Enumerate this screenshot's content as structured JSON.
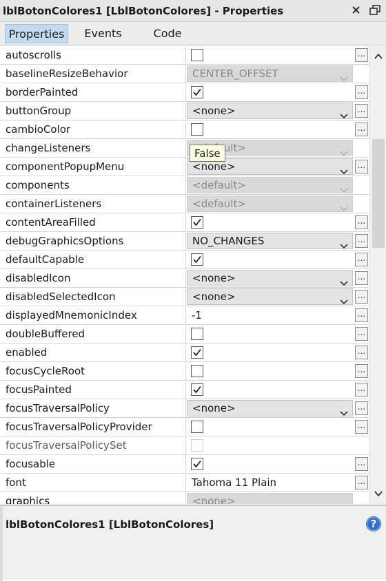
{
  "window": {
    "title": "lblBotonColores1 [LblBotonColores] - Properties",
    "close_icon": "close-icon",
    "maximize_icon": "maximize-icon"
  },
  "tabs": [
    {
      "label": "Properties",
      "active": true
    },
    {
      "label": "Events",
      "active": false
    },
    {
      "label": "Code",
      "active": false
    }
  ],
  "properties": [
    {
      "name": "autoscrolls",
      "type": "checkbox",
      "checked": false,
      "editor": true
    },
    {
      "name": "baselineResizeBehavior",
      "type": "combo",
      "value": "CENTER_OFFSET",
      "disabled": true,
      "editor": false
    },
    {
      "name": "borderPainted",
      "type": "checkbox",
      "checked": true,
      "editor": true
    },
    {
      "name": "buttonGroup",
      "type": "combo",
      "value": "<none>",
      "disabled": false,
      "editor": true
    },
    {
      "name": "cambioColor",
      "type": "checkbox",
      "checked": false,
      "editor": true
    },
    {
      "name": "changeListeners",
      "type": "combo",
      "value": "<default>",
      "disabled": true,
      "editor": false
    },
    {
      "name": "componentPopupMenu",
      "type": "combo",
      "value": "<none>",
      "disabled": false,
      "editor": true
    },
    {
      "name": "components",
      "type": "combo",
      "value": "<default>",
      "disabled": true,
      "editor": false
    },
    {
      "name": "containerListeners",
      "type": "combo",
      "value": "<default>",
      "disabled": true,
      "editor": false
    },
    {
      "name": "contentAreaFilled",
      "type": "checkbox",
      "checked": true,
      "editor": true
    },
    {
      "name": "debugGraphicsOptions",
      "type": "combo",
      "value": "NO_CHANGES",
      "disabled": false,
      "editor": true
    },
    {
      "name": "defaultCapable",
      "type": "checkbox",
      "checked": true,
      "editor": true
    },
    {
      "name": "disabledIcon",
      "type": "combo",
      "value": "<none>",
      "disabled": false,
      "editor": true
    },
    {
      "name": "disabledSelectedIcon",
      "type": "combo",
      "value": "<none>",
      "disabled": false,
      "editor": true
    },
    {
      "name": "displayedMnemonicIndex",
      "type": "text",
      "value": "-1",
      "editor": true
    },
    {
      "name": "doubleBuffered",
      "type": "checkbox",
      "checked": false,
      "editor": true
    },
    {
      "name": "enabled",
      "type": "checkbox",
      "checked": true,
      "editor": true
    },
    {
      "name": "focusCycleRoot",
      "type": "checkbox",
      "checked": false,
      "editor": true
    },
    {
      "name": "focusPainted",
      "type": "checkbox",
      "checked": true,
      "editor": true
    },
    {
      "name": "focusTraversalPolicy",
      "type": "combo",
      "value": "<none>",
      "disabled": false,
      "editor": true
    },
    {
      "name": "focusTraversalPolicyProvider",
      "type": "checkbox",
      "checked": false,
      "editor": true
    },
    {
      "name": "focusTraversalPolicySet",
      "type": "checkbox",
      "checked": false,
      "disabled": true,
      "editor": false,
      "dim": true
    },
    {
      "name": "focusable",
      "type": "checkbox",
      "checked": true,
      "editor": true
    },
    {
      "name": "font",
      "type": "text",
      "value": "Tahoma 11 Plain",
      "editor": true
    },
    {
      "name": "graphics",
      "type": "combo",
      "value": "<none>",
      "disabled": true,
      "editor": false
    }
  ],
  "tooltip": {
    "text": "False"
  },
  "description": {
    "title": "lblBotonColores1 [LblBotonColores]",
    "help_icon": "help-icon"
  },
  "colors": {
    "tab_active": "#c4daf0",
    "tooltip_bg": "#ffffe1",
    "help_blue": "#2e6fd1"
  }
}
